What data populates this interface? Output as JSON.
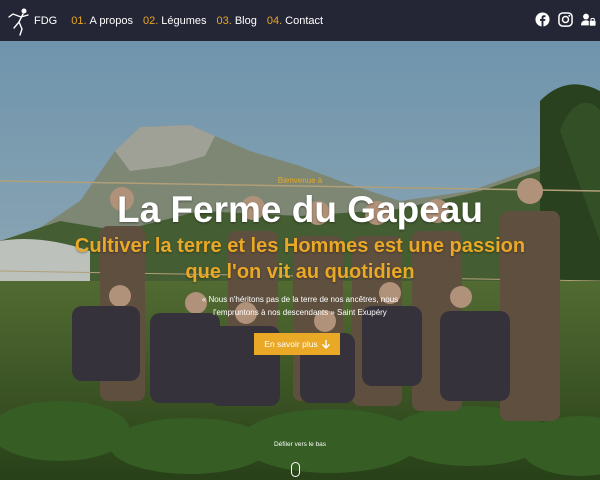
{
  "nav": {
    "brand": "FDG",
    "items": [
      {
        "number": "01.",
        "label": "A propos"
      },
      {
        "number": "02.",
        "label": "Légumes"
      },
      {
        "number": "03.",
        "label": "Blog"
      },
      {
        "number": "04.",
        "label": "Contact"
      }
    ],
    "icons": [
      "facebook-icon",
      "instagram-icon",
      "user-lock-icon"
    ]
  },
  "hero": {
    "eyebrow": "Bienvenue à",
    "title": "La Ferme du Gapeau",
    "subtitle": "Cultiver la terre et les Hommes est une passion que l'on vit au quotidien",
    "quote": "« Nous n'héritons pas de la terre de nos ancêtres, nous l'empruntons à nos descendants » Saint Exupéry",
    "cta_label": "En savoir plus",
    "scroll_label": "Défiler vers le bas"
  },
  "colors": {
    "nav_background": "#242535",
    "accent": "#e9a825",
    "text": "#ffffff"
  }
}
